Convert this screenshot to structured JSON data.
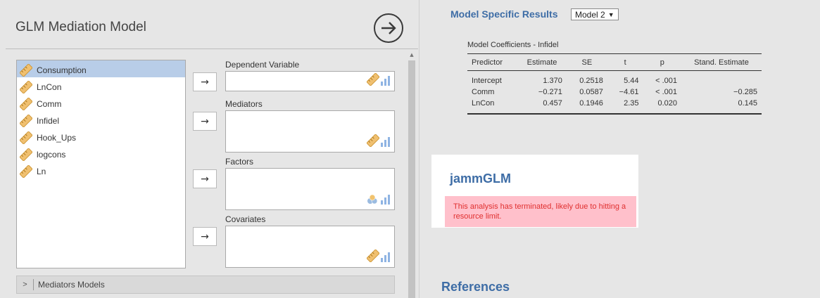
{
  "options_panel": {
    "title": "GLM Mediation Model",
    "variables": [
      "Consumption",
      "LnCon",
      "Comm",
      "Infidel",
      "Hook_Ups",
      "logcons",
      "Ln"
    ],
    "selected_variable": "Consumption",
    "targets": [
      {
        "label": "Dependent Variable",
        "icon": "continuous-icon"
      },
      {
        "label": "Mediators",
        "icon": "continuous-icon"
      },
      {
        "label": "Factors",
        "icon": "nominal-icon"
      },
      {
        "label": "Covariates",
        "icon": "continuous-icon"
      }
    ],
    "arrow_glyph": "→",
    "collapsible_section": "Mediators Models"
  },
  "results": {
    "section_title": "Model Specific Results",
    "model_select": "Model 2",
    "table": {
      "caption": "Model Coefficients - Infidel",
      "columns": [
        "Predictor",
        "Estimate",
        "SE",
        "t",
        "p",
        "Stand. Estimate"
      ],
      "rows": [
        [
          "Intercept",
          "1.370",
          "0.2518",
          "5.44",
          "< .001",
          ""
        ],
        [
          "Comm",
          "−0.271",
          "0.0587",
          "−4.61",
          "< .001",
          "−0.285"
        ],
        [
          "LnCon",
          "0.457",
          "0.1946",
          "2.35",
          "0.020",
          "0.145"
        ]
      ]
    },
    "error_card": {
      "title": "jammGLM",
      "message": "This analysis has terminated, likely due to hitting a resource limit."
    },
    "references_title": "References"
  },
  "colors": {
    "accent_blue": "#3e6da6",
    "selected_row": "#b8cde8",
    "error_bg": "#ffc0cb",
    "error_text": "#e03030",
    "ruler_icon": "#f0c070",
    "bar_icon": "#8fb4e3"
  }
}
